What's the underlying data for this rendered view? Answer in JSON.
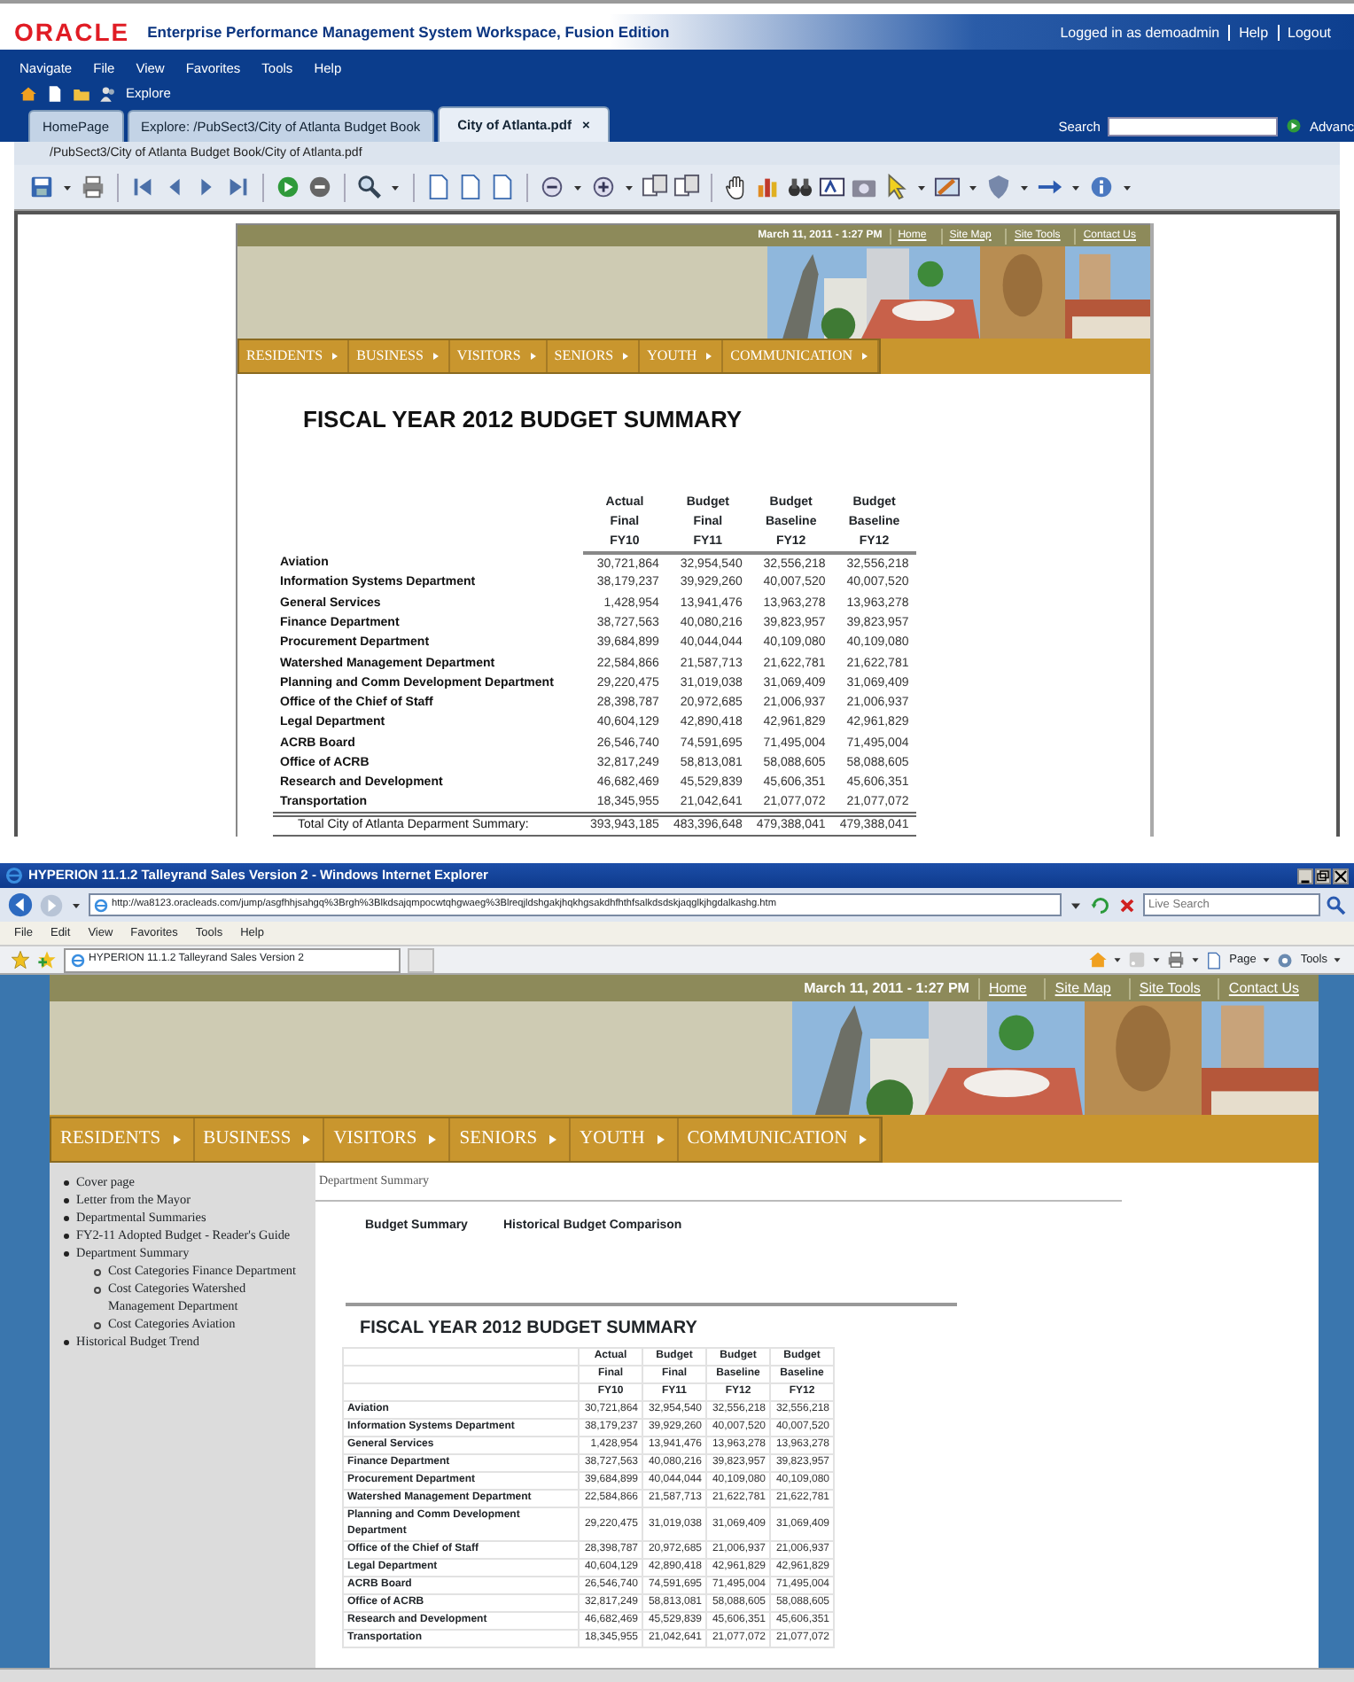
{
  "workspace": {
    "header": {
      "logo": "ORACLE",
      "title": "Enterprise Performance Management System Workspace, Fusion Edition",
      "user": "Logged in as demoadmin",
      "links": [
        "Help",
        "Logout"
      ]
    },
    "menu": [
      "Navigate",
      "File",
      "View",
      "Favorites",
      "Tools",
      "Help"
    ],
    "explore": "Explore",
    "tabs": [
      {
        "label": "HomePage",
        "selected": false
      },
      {
        "label": "Explore: /PubSect3/City of Atlanta Budget Book",
        "selected": false
      },
      {
        "label": "City of Atlanta.pdf",
        "selected": true,
        "close": "×"
      }
    ],
    "search": {
      "label": "Search",
      "advanced": "Advanc"
    },
    "path": "/PubSect3/City of Atlanta Budget Book/City of Atlanta.pdf",
    "document": {
      "site": {
        "date": "March 11, 2011 - 1:27 PM",
        "links": [
          "Home",
          "Site Map",
          "Site Tools",
          "Contact Us"
        ],
        "nav": [
          "RESIDENTS",
          "BUSINESS",
          "VISITORS",
          "SENIORS",
          "YOUTH",
          "COMMUNICATION"
        ]
      },
      "title": "FISCAL YEAR 2012 BUDGET SUMMARY",
      "table": {
        "header_rows": [
          [
            "Actual",
            "Budget",
            "Budget",
            "Budget"
          ],
          [
            "Final",
            "Final",
            "Baseline",
            "Baseline"
          ],
          [
            "FY10",
            "FY11",
            "FY12",
            "FY12"
          ]
        ],
        "rows": [
          [
            "Aviation",
            "30,721,864",
            "32,954,540",
            "32,556,218",
            "32,556,218"
          ],
          [
            "Information Systems Department",
            "38,179,237",
            "39,929,260",
            "40,007,520",
            "40,007,520"
          ],
          [
            "General Services",
            "1,428,954",
            "13,941,476",
            "13,963,278",
            "13,963,278"
          ],
          [
            "Finance Department",
            "38,727,563",
            "40,080,216",
            "39,823,957",
            "39,823,957"
          ],
          [
            "Procurement Department",
            "39,684,899",
            "40,044,044",
            "40,109,080",
            "40,109,080"
          ],
          [
            "Watershed Management Department",
            "22,584,866",
            "21,587,713",
            "21,622,781",
            "21,622,781"
          ],
          [
            "Planning and Comm Development Department",
            "29,220,475",
            "31,019,038",
            "31,069,409",
            "31,069,409"
          ],
          [
            "Office of the Chief of Staff",
            "28,398,787",
            "20,972,685",
            "21,006,937",
            "21,006,937"
          ],
          [
            "Legal Department",
            "40,604,129",
            "42,890,418",
            "42,961,829",
            "42,961,829"
          ],
          [
            "ACRB Board",
            "26,546,740",
            "74,591,695",
            "71,495,004",
            "71,495,004"
          ],
          [
            "Office of ACRB",
            "32,817,249",
            "58,813,081",
            "58,088,605",
            "58,088,605"
          ],
          [
            "Research and Development",
            "46,682,469",
            "45,529,839",
            "45,606,351",
            "45,606,351"
          ],
          [
            "Transportation",
            "18,345,955",
            "21,042,641",
            "21,077,072",
            "21,077,072"
          ]
        ],
        "total": [
          "Total City of Atlanta Deparment Summary:",
          "393,943,185",
          "483,396,648",
          "479,388,041",
          "479,388,041"
        ]
      }
    }
  },
  "browser": {
    "title": "HYPERION 11.1.2 Talleyrand Sales Version 2 - Windows Internet Explorer",
    "url": "http://wa8123.oracleads.com/jump/asgfhhjsahgq%3Brgh%3Blkdsajqmpocwtqhgwaeg%3Blreqjldshgakjhqkhgsakdhfhthfsalkdsdskjaqglkjhgdalkashg.htm",
    "search_placeholder": "Live Search",
    "menu": [
      "File",
      "Edit",
      "View",
      "Favorites",
      "Tools",
      "Help"
    ],
    "tab": "HYPERION 11.1.2 Talleyrand Sales Version 2",
    "commands": [
      "Page",
      "Tools"
    ],
    "page": {
      "site": {
        "date": "March 11, 2011 - 1:27 PM",
        "links": [
          "Home",
          "Site Map",
          "Site Tools",
          "Contact Us"
        ],
        "nav": [
          "RESIDENTS",
          "BUSINESS",
          "VISITORS",
          "SENIORS",
          "YOUTH",
          "COMMUNICATION"
        ]
      },
      "sidebar": [
        {
          "label": "Cover page"
        },
        {
          "label": "Letter from the Mayor"
        },
        {
          "label": "Departmental Summaries"
        },
        {
          "label": "FY2-11 Adopted Budget - Reader's Guide"
        },
        {
          "label": "Department Summary",
          "children": [
            {
              "label": "Cost Categories Finance Department"
            },
            {
              "label": "Cost Categories Watershed Management Department"
            },
            {
              "label": "Cost Categories Aviation"
            }
          ]
        },
        {
          "label": "Historical Budget Trend"
        }
      ],
      "breadcrumb": "Department Summary",
      "tabs": [
        "Budget Summary",
        "Historical Budget Comparison"
      ],
      "title": "FISCAL YEAR 2012 BUDGET SUMMARY",
      "table": {
        "header_rows": [
          [
            "Actual",
            "Budget",
            "Budget",
            "Budget"
          ],
          [
            "Final",
            "Final",
            "Baseline",
            "Baseline"
          ],
          [
            "FY10",
            "FY11",
            "FY12",
            "FY12"
          ]
        ],
        "rows": [
          [
            "Aviation",
            "30,721,864",
            "32,954,540",
            "32,556,218",
            "32,556,218"
          ],
          [
            "Information Systems Department",
            "38,179,237",
            "39,929,260",
            "40,007,520",
            "40,007,520"
          ],
          [
            "General Services",
            "1,428,954",
            "13,941,476",
            "13,963,278",
            "13,963,278"
          ],
          [
            "Finance Department",
            "38,727,563",
            "40,080,216",
            "39,823,957",
            "39,823,957"
          ],
          [
            "Procurement Department",
            "39,684,899",
            "40,044,044",
            "40,109,080",
            "40,109,080"
          ],
          [
            "Watershed Management Department",
            "22,584,866",
            "21,587,713",
            "21,622,781",
            "21,622,781"
          ],
          [
            "Planning and Comm Development Department",
            "29,220,475",
            "31,019,038",
            "31,069,409",
            "31,069,409"
          ],
          [
            "Office of the Chief of Staff",
            "28,398,787",
            "20,972,685",
            "21,006,937",
            "21,006,937"
          ],
          [
            "Legal Department",
            "40,604,129",
            "42,890,418",
            "42,961,829",
            "42,961,829"
          ],
          [
            "ACRB Board",
            "26,546,740",
            "74,591,695",
            "71,495,004",
            "71,495,004"
          ],
          [
            "Office of ACRB",
            "32,817,249",
            "58,813,081",
            "58,088,605",
            "58,088,605"
          ],
          [
            "Research and Development",
            "46,682,469",
            "45,529,839",
            "45,606,351",
            "45,606,351"
          ],
          [
            "Transportation",
            "18,345,955",
            "21,042,641",
            "21,077,072",
            "21,077,072"
          ]
        ]
      }
    }
  }
}
